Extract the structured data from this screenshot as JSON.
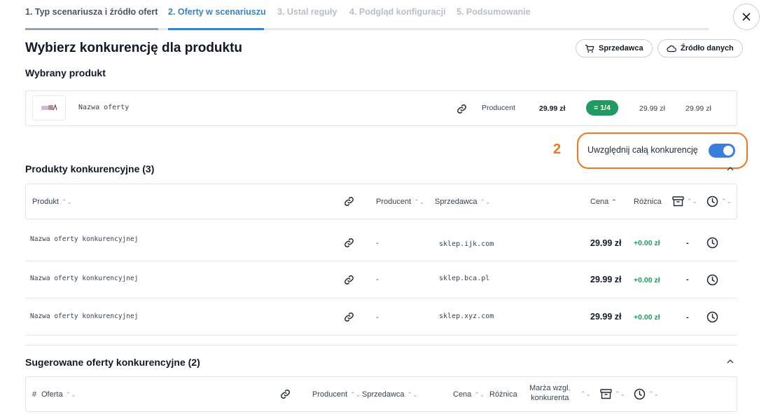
{
  "steps": [
    {
      "label": "1. Typ scenariusza i źródło ofert",
      "state": "done"
    },
    {
      "label": "2. Oferty w scenariuszu",
      "state": "active"
    },
    {
      "label": "3. Ustal reguły",
      "state": "upcoming"
    },
    {
      "label": "4. Podgląd konfiguracji",
      "state": "upcoming"
    },
    {
      "label": "5. Podsumowanie",
      "state": "upcoming"
    }
  ],
  "page_title": "Wybierz konkurencję dla produktu",
  "header_buttons": {
    "seller": "Sprzedawca",
    "data_source": "Źródło danych"
  },
  "selected_product": {
    "section_label": "Wybrany produkt",
    "name": "Nazwa oferty",
    "producer": "Producent",
    "price": "29.99 zł",
    "rank_badge": "= 1/4",
    "price_2": "29.99 zł",
    "price_3": "29.99 zł"
  },
  "annotation_number": "2",
  "include_all": {
    "label": "Uwzględnij całą konkurencję",
    "enabled": true
  },
  "competitors": {
    "section_label": "Produkty konkurencyjne (3)",
    "headers": {
      "product": "Produkt",
      "producer": "Producent",
      "seller": "Sprzedawca",
      "price": "Cena",
      "difference": "Różnica"
    },
    "rows": [
      {
        "name": "Nazwa oferty konkurencyjnej",
        "producer": "-",
        "seller": "sklep.ijk.com",
        "price": "29.99 zł",
        "difference": "+0.00 zł",
        "stock": "-"
      },
      {
        "name": "Nazwa oferty konkurencyjnej",
        "producer": "-",
        "seller": "sklep.bca.pl",
        "price": "29.99 zł",
        "difference": "+0.00 zł",
        "stock": "-"
      },
      {
        "name": "Nazwa oferty konkurencyjnej",
        "producer": "-",
        "seller": "sklep.xyz.com",
        "price": "29.99 zł",
        "difference": "+0.00 zł",
        "stock": "-"
      }
    ]
  },
  "suggested": {
    "section_label": "Sugerowane oferty konkurencyjne (2)",
    "headers": {
      "index": "#",
      "offer": "Oferta",
      "producer": "Producent",
      "seller": "Sprzedawca",
      "price": "Cena",
      "difference": "Różnica",
      "margin_line1": "Marża wzgl.",
      "margin_line2": "konkurenta"
    }
  },
  "colors": {
    "accent": "#3b82c4",
    "success": "#1f9a60",
    "highlight": "#f07622",
    "toggle": "#3b7ddd"
  }
}
